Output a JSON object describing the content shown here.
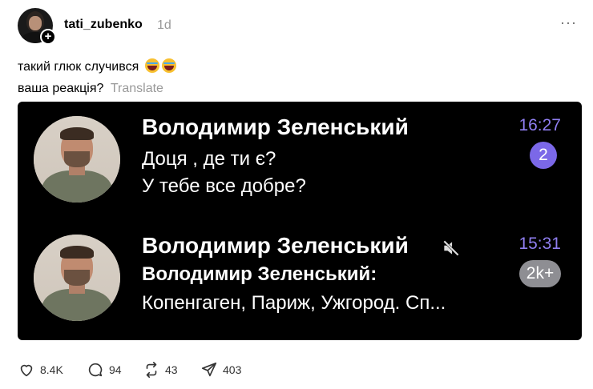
{
  "post": {
    "username": "tati_zubenko",
    "time_ago": "1d",
    "more_label": "···",
    "text_line1": "такий глюк случився",
    "text_line2": "ваша реакція?",
    "translate_label": "Translate"
  },
  "chats": [
    {
      "name": "Володимир Зеленський",
      "line1": "Доця , де ти є?",
      "line2": "У тебе все добре?",
      "time": "16:27",
      "unread": "2"
    },
    {
      "name": "Володимир Зеленський",
      "line1": "Володимир Зеленський:",
      "line2": "Копенгаген, Париж, Ужгород. Сп...",
      "time": "15:31",
      "unread": "2k+",
      "muted": true
    }
  ],
  "actions": {
    "likes": "8.4K",
    "comments": "94",
    "reposts": "43",
    "shares": "403"
  }
}
